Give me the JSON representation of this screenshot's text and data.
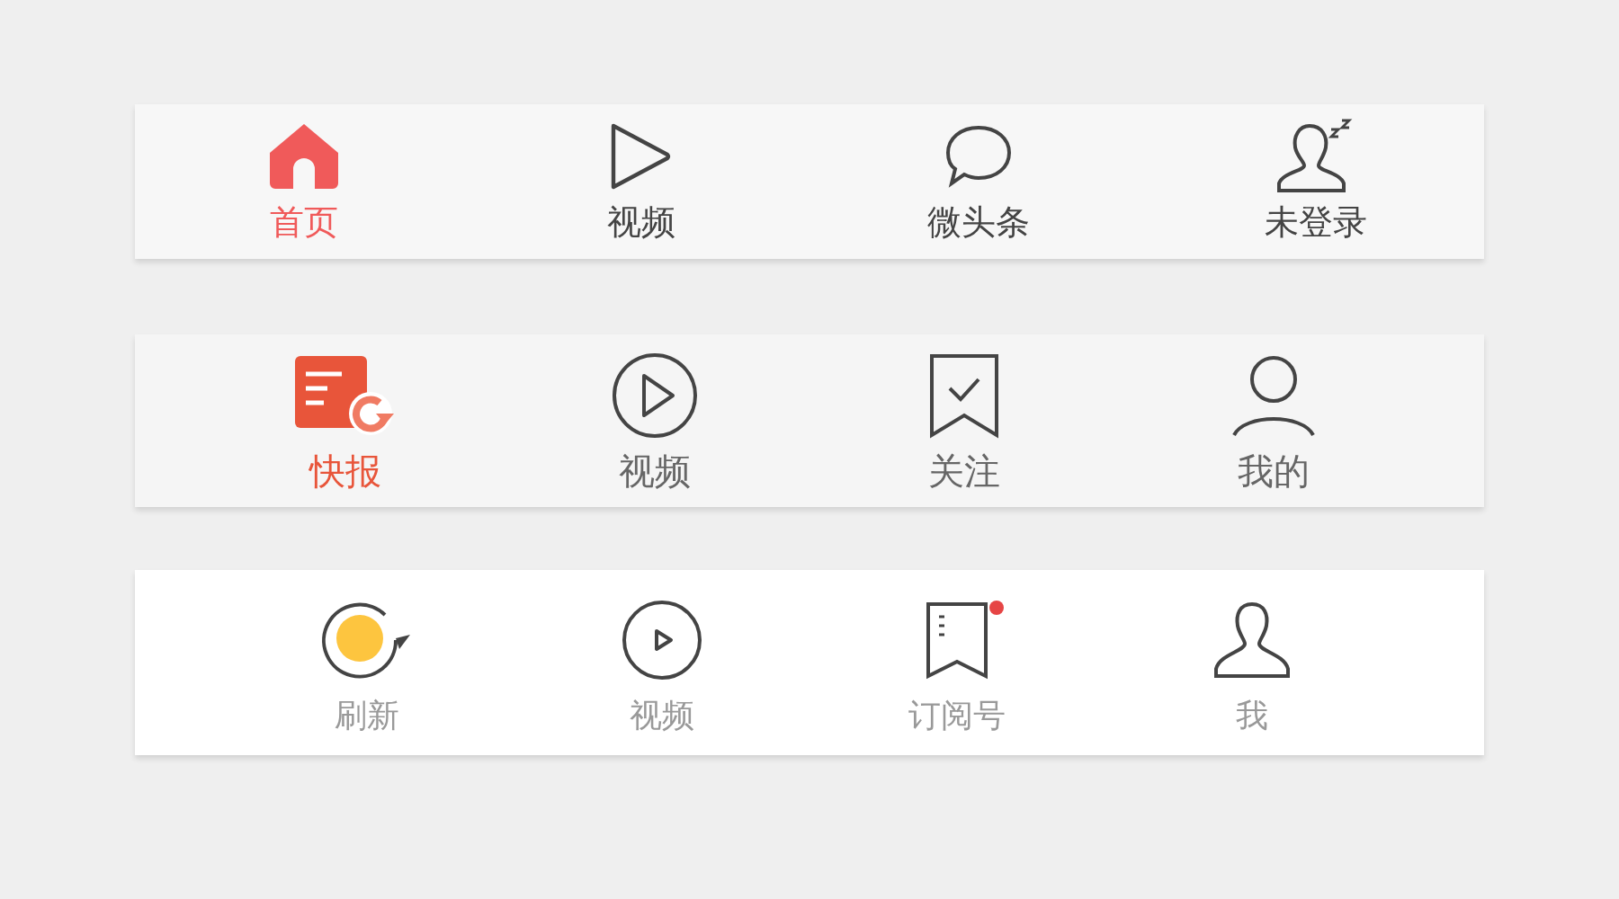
{
  "tab_bars": [
    {
      "tabs": [
        {
          "label": "首页",
          "selected": true
        },
        {
          "label": "视频",
          "selected": false
        },
        {
          "label": "微头条",
          "selected": false
        },
        {
          "label": "未登录",
          "selected": false
        }
      ]
    },
    {
      "tabs": [
        {
          "label": "快报",
          "selected": true
        },
        {
          "label": "视频",
          "selected": false
        },
        {
          "label": "关注",
          "selected": false
        },
        {
          "label": "我的",
          "selected": false
        }
      ]
    },
    {
      "tabs": [
        {
          "label": "刷新",
          "badge": false
        },
        {
          "label": "视频",
          "badge": false
        },
        {
          "label": "订阅号",
          "badge": true
        },
        {
          "label": "我",
          "badge": false
        }
      ]
    }
  ]
}
